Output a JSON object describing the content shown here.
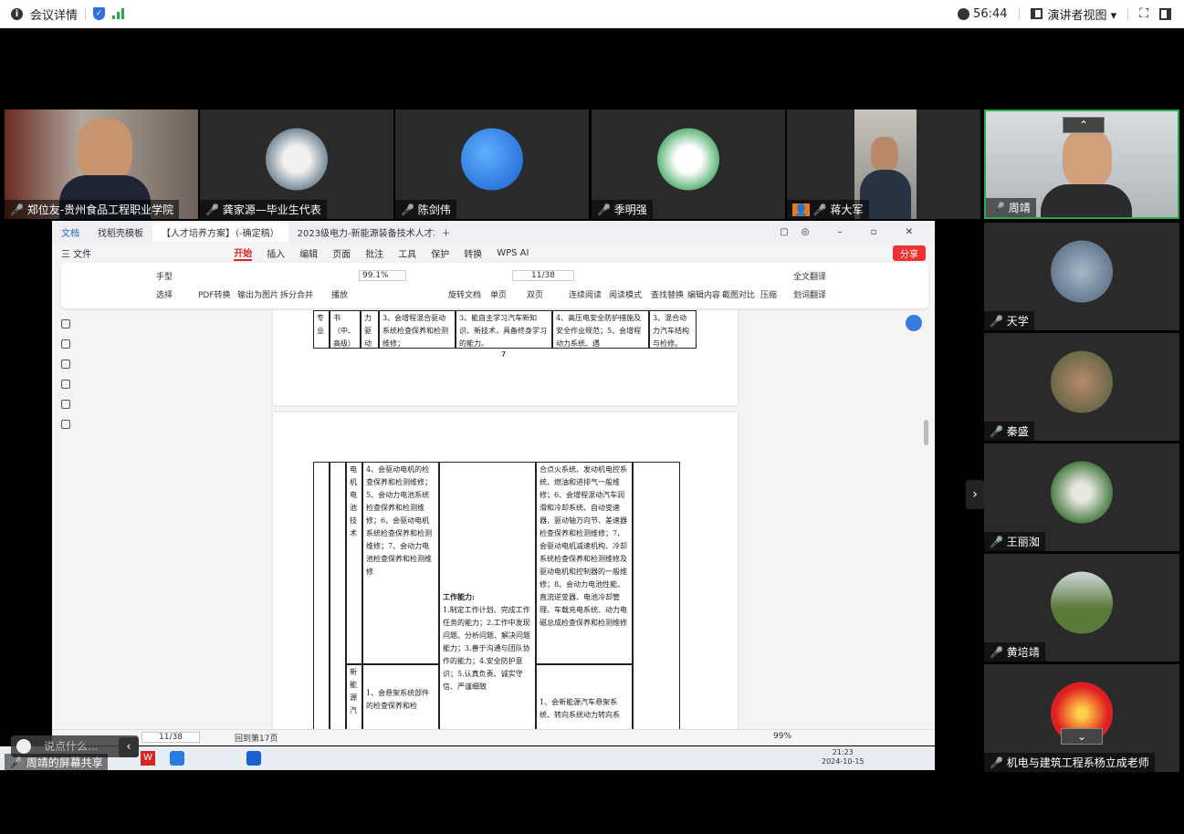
{
  "topbar": {
    "meeting_info": "会议详情",
    "timer": "56:44",
    "view_mode": "演讲者视图 ▾"
  },
  "tiles": [
    {
      "name": "郑位友-贵州食品工程职业学院"
    },
    {
      "name": "龚家源—毕业生代表"
    },
    {
      "name": "陈剑伟"
    },
    {
      "name": "季明强"
    },
    {
      "name": "蒋大军"
    },
    {
      "name": "周靖"
    }
  ],
  "sidebar": [
    {
      "name": "天学"
    },
    {
      "name": "秦盛"
    },
    {
      "name": "王丽洳"
    },
    {
      "name": "黄培靖"
    },
    {
      "name": "机电与建筑工程系杨立成老师"
    }
  ],
  "wps": {
    "tabs": [
      "文档",
      "找稻壳模板",
      "【人才培养方案】（-确定稿）",
      "2023级电力-新能源装备技术人才培..."
    ],
    "menu": [
      "三 文件",
      "开始",
      "插入",
      "编辑",
      "页面",
      "批注",
      "工具",
      "保护",
      "转换",
      "WPS AI"
    ],
    "share": "分享",
    "ribbon": {
      "hand": "手型",
      "select": "选择",
      "pdf": "PDF转换",
      "export_img": "输出为图片",
      "split": "拆分合并",
      "play": "播放",
      "zoom": "99.1%",
      "page": "11/38",
      "rotate": "旋转文档",
      "single": "单页",
      "double": "双页",
      "continuous": "连续阅读",
      "read_mode": "阅读模式",
      "find": "查找替换",
      "edit": "编辑内容",
      "compare": "截图对比",
      "compress": "压缩",
      "translate": "全文翻译",
      "word_translate": "划词翻译"
    },
    "page_number": "7",
    "page1": {
      "c1": "专业",
      "c2": "书（中、高级）",
      "c3": "力驱动",
      "c4": "3、会增程混合驱动系统检查保养和检测维修；",
      "c5": "3、能自主学习汽车新知识、新技术，具备终身学习的能力。",
      "c6": "4、高压电安全防护措施及安全作业规范；5、会增程动力系统、遇",
      "c7": "3、混合动力汽车结构与检修。"
    },
    "page2": {
      "c_tech": "电机电池技术",
      "c_skill": "4、会驱动电机的检查保养和检测维修；5、会动力电池系统检查保养和检测维修；6、会驱动电机系统检查保养和检测维修；7、会动力电池检查保养和检测维修",
      "c_work_title": "工作能力:",
      "c_work": "1.制定工作计划、完成工作任务的能力；2.工作中发现问题、分析问题、解决问题能力；3.善于沟通与团队协作的能力；4.安全防护意识；5.认真负责、诚实守信、严谨细致",
      "c_right": "合点火系统、发动机电控系统、燃油和进排气一般维修；6、会增程混动汽车润滑和冷却系统、自动变速器、驱动轴万向节、差速器检查保养和检测维修；7、会驱动电机减速机构、冷却系统检查保养和检测维修及驱动电机和控制器的一般维修；8、会动力电池性能、直流逆变器、电池冷却管理、车载充电系统、动力电磁总成检查保养和检测维修",
      "c_new": "新能源汽",
      "c_susp": "1、会悬架系统部件的检查保养和检",
      "c_susp2": "1、会新能源汽车悬架系统、转向系统动力转向系"
    },
    "status": {
      "page": "11/38",
      "back": "回到第17页",
      "zoom": "99%"
    }
  },
  "taskbar": {
    "chat_placeholder": "说点什么...",
    "screen_share": "周靖的屏幕共享",
    "time": "21:23",
    "date": "2024-10-15"
  },
  "colors": {
    "accent": "#d22",
    "speaking": "#2aa84a"
  }
}
